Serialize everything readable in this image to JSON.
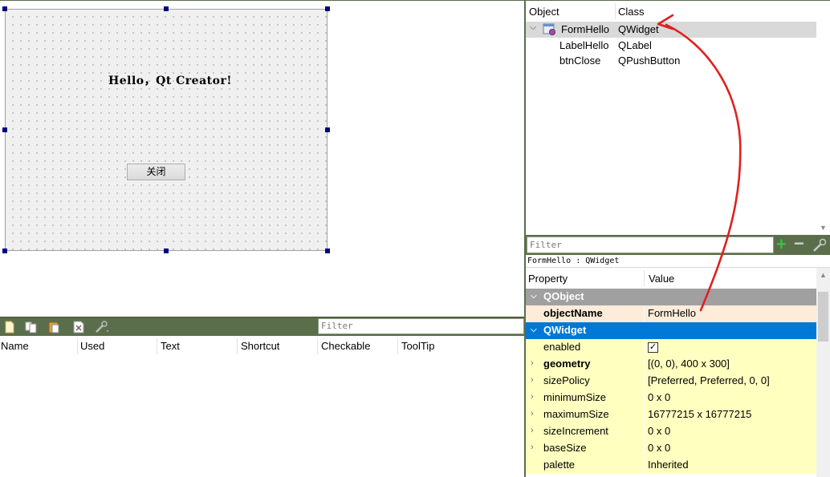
{
  "form": {
    "label_text": "Hello，Qt Creator!",
    "button_text": "关闭"
  },
  "action_editor": {
    "filter_placeholder": "Filter",
    "columns": [
      "Name",
      "Used",
      "Text",
      "Shortcut",
      "Checkable",
      "ToolTip"
    ],
    "toolbar_icons": [
      "new-action-icon",
      "copy-action-icon",
      "paste-action-icon",
      "delete-action-icon",
      "configure-icon"
    ]
  },
  "object_inspector": {
    "col_object": "Object",
    "col_class": "Class",
    "rows": [
      {
        "object": "FormHello",
        "class": "QWidget"
      },
      {
        "object": "LabelHello",
        "class": "QLabel"
      },
      {
        "object": "btnClose",
        "class": "QPushButton"
      }
    ],
    "filter_placeholder": "Filter",
    "current_caption": "FormHello : QWidget"
  },
  "property_editor": {
    "col_property": "Property",
    "col_value": "Value",
    "groups": {
      "qobject": "QObject",
      "qwidget": "QWidget"
    },
    "rows": [
      {
        "name": "objectName",
        "value": "FormHello"
      },
      {
        "name": "enabled",
        "value": ""
      },
      {
        "name": "geometry",
        "value": "[(0, 0), 400 x 300]"
      },
      {
        "name": "sizePolicy",
        "value": "[Preferred, Preferred, 0, 0]"
      },
      {
        "name": "minimumSize",
        "value": "0 x 0"
      },
      {
        "name": "maximumSize",
        "value": "16777215 x 16777215"
      },
      {
        "name": "sizeIncrement",
        "value": "0 x 0"
      },
      {
        "name": "baseSize",
        "value": "0 x 0"
      },
      {
        "name": "palette",
        "value": "Inherited"
      }
    ]
  },
  "colors": {
    "panel_green": "#5b6e4b",
    "group_qobject": "#a0a0a0",
    "group_qwidget": "#0078d7",
    "row_qobject": "#fdecd9",
    "row_qwidget": "#ffffc0",
    "annotation_red": "#e02020"
  }
}
